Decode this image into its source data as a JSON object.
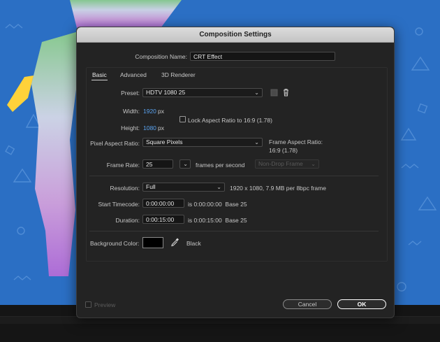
{
  "dialog": {
    "title": "Composition Settings"
  },
  "composition_name": {
    "label": "Composition Name:",
    "value": "CRT Effect"
  },
  "tabs": [
    {
      "label": "Basic",
      "active": true
    },
    {
      "label": "Advanced",
      "active": false
    },
    {
      "label": "3D Renderer",
      "active": false
    }
  ],
  "preset": {
    "label": "Preset:",
    "value": "HDTV 1080 25"
  },
  "width": {
    "label": "Width:",
    "value": "1920",
    "unit": "px"
  },
  "height": {
    "label": "Height:",
    "value": "1080",
    "unit": "px"
  },
  "lock_aspect": {
    "label": "Lock Aspect Ratio to 16:9 (1.78)",
    "checked": false
  },
  "pixel_aspect": {
    "label": "Pixel Aspect Ratio:",
    "value": "Square Pixels",
    "frame_aspect_label": "Frame Aspect Ratio:",
    "frame_aspect_value": "16:9 (1.78)"
  },
  "frame_rate": {
    "label": "Frame Rate:",
    "value": "25",
    "unit": "frames per second",
    "drop_frame": "Non-Drop Frame"
  },
  "resolution": {
    "label": "Resolution:",
    "value": "Full",
    "info": "1920 x 1080, 7.9 MB per 8bpc frame"
  },
  "start_timecode": {
    "label": "Start Timecode:",
    "value": "0:00:00:00",
    "info": "is 0:00:00:00  Base 25"
  },
  "duration": {
    "label": "Duration:",
    "value": "0:00:15:00",
    "info": "is 0:00:15:00  Base 25"
  },
  "background_color": {
    "label": "Background Color:",
    "name": "Black",
    "color": "#000000"
  },
  "footer": {
    "preview_label": "Preview",
    "cancel_label": "Cancel",
    "ok_label": "OK"
  },
  "colors": {
    "accent_value": "#5aa3f0",
    "dialog_bg": "#232323",
    "backdrop": "#2b6fc4"
  }
}
